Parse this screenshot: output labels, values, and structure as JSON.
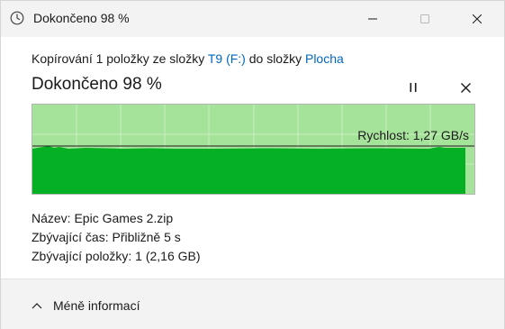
{
  "window": {
    "title": "Dokončeno 98 %",
    "icon": "clock-icon"
  },
  "content": {
    "copy_prefix": "Kopírování 1 položky ze složky ",
    "source": "T9 (F:)",
    "copy_middle": " do složky ",
    "destination": "Plocha",
    "heading": "Dokončeno 98 %",
    "progress_percent": 98,
    "speed_label": "Rychlost: 1,27 GB/s"
  },
  "details": {
    "name_label": "Název:",
    "name_value": "Epic Games 2.zip",
    "time_label": "Zbývající čas:",
    "time_value": "Přibližně 5 s",
    "items_label": "Zbývající položky:",
    "items_value": "1 (2,16 GB)"
  },
  "footer": {
    "less_info_label": "Méně informací"
  },
  "colors": {
    "progress_fill": "#06b025",
    "progress_remaining": "#a6e39a",
    "link": "#0067c0"
  }
}
